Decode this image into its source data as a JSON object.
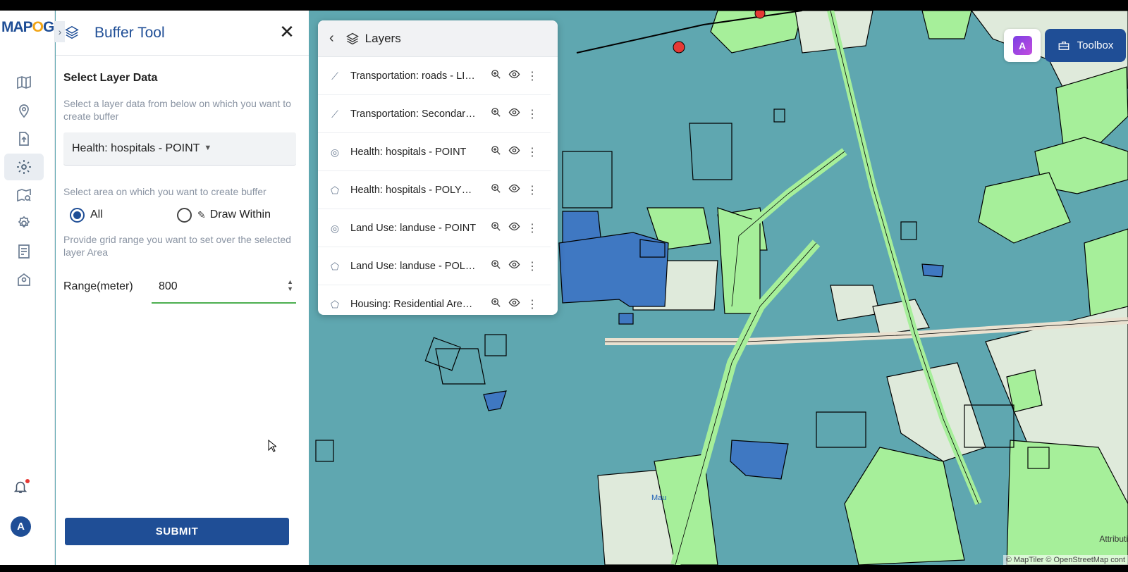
{
  "app": {
    "logo_prefix": "MAP",
    "logo_o": "O",
    "logo_suffix": "G"
  },
  "rail": {
    "items": [
      "map-icon",
      "location-pin-icon",
      "upload-file-icon",
      "gear-icon",
      "map-search-icon",
      "settings-icon",
      "checklist-icon",
      "map-pin-icon"
    ],
    "active_index": 3,
    "avatar_initial": "A"
  },
  "buffer_panel": {
    "title": "Buffer Tool",
    "close": "✕",
    "section_title": "Select Layer Data",
    "select_hint": "Select a layer data from below on which you want to create buffer",
    "selected_layer": "Health: hospitals - POINT",
    "area_hint": "Select area on which you want to create buffer",
    "radio_all": "All",
    "radio_draw": "Draw Within",
    "radio_selected": "All",
    "grid_hint": "Provide grid range you want to set over the selected layer Area",
    "range_label": "Range(meter)",
    "range_value": "800",
    "submit_label": "SUBMIT"
  },
  "layers_panel": {
    "title": "Layers",
    "items": [
      {
        "name": "Transportation: roads - LI…",
        "type": "line"
      },
      {
        "name": "Transportation: Secondar…",
        "type": "line"
      },
      {
        "name": "Health: hospitals - POINT",
        "type": "point"
      },
      {
        "name": "Health: hospitals - POLY…",
        "type": "polygon"
      },
      {
        "name": "Land Use: landuse - POINT",
        "type": "point"
      },
      {
        "name": "Land Use: landuse - POL…",
        "type": "polygon"
      },
      {
        "name": "Housing: Residential Are…",
        "type": "polygon"
      }
    ]
  },
  "toolbar": {
    "ai_label": "A",
    "toolbox_label": "Toolbox"
  },
  "map": {
    "place_label": "Mau",
    "attribution_link": "Attributi",
    "attribution": "© MapTiler © OpenStreetMap cont",
    "colors": {
      "water": "#5fa7b0",
      "green": "#a6ef9a",
      "light": "#dfeadb",
      "blue": "#4a86c6",
      "road": "#e9e1d0"
    }
  }
}
